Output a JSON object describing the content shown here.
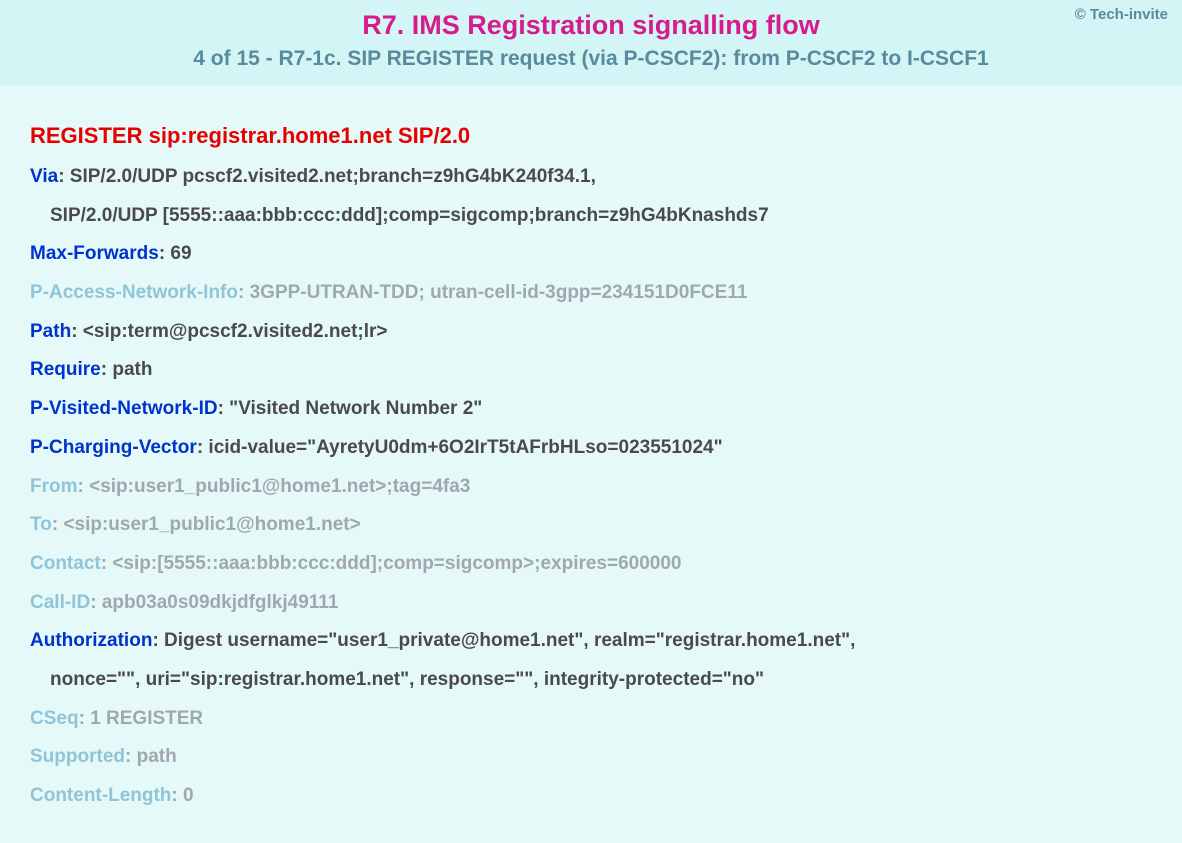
{
  "header": {
    "title": "R7. IMS Registration signalling flow",
    "subtitle": "4 of 15 - R7-1c. SIP REGISTER request (via P-CSCF2): from P-CSCF2 to I-CSCF1",
    "copyright": "© Tech-invite"
  },
  "request": {
    "method": "REGISTER",
    "uri": "sip:registrar.home1.net SIP/2.0"
  },
  "headers": {
    "via": {
      "name": "Via",
      "value1": ": SIP/2.0/UDP pcscf2.visited2.net;branch=z9hG4bK240f34.1,",
      "value2": "SIP/2.0/UDP [5555::aaa:bbb:ccc:ddd];comp=sigcomp;branch=z9hG4bKnashds7"
    },
    "maxforwards": {
      "name": "Max-Forwards",
      "value": ": 69"
    },
    "pani": {
      "name": "P-Access-Network-Info",
      "value": ": 3GPP-UTRAN-TDD; utran-cell-id-3gpp=234151D0FCE11"
    },
    "path": {
      "name": "Path",
      "value": ": <sip:term@pcscf2.visited2.net;lr>"
    },
    "require": {
      "name": "Require",
      "value": ": path"
    },
    "pvni": {
      "name": "P-Visited-Network-ID",
      "value": ": \"Visited Network Number 2\""
    },
    "pcv": {
      "name": "P-Charging-Vector",
      "value": ": icid-value=\"AyretyU0dm+6O2IrT5tAFrbHLso=023551024\""
    },
    "from": {
      "name": "From",
      "value": ": <sip:user1_public1@home1.net>;tag=4fa3"
    },
    "to": {
      "name": "To",
      "value": ": <sip:user1_public1@home1.net>"
    },
    "contact": {
      "name": "Contact",
      "value": ": <sip:[5555::aaa:bbb:ccc:ddd];comp=sigcomp>;expires=600000"
    },
    "callid": {
      "name": "Call-ID",
      "value": ": apb03a0s09dkjdfglkj49111"
    },
    "auth": {
      "name": "Authorization",
      "value1": ": Digest username=\"user1_private@home1.net\", realm=\"registrar.home1.net\",",
      "value2": "nonce=\"\", uri=\"sip:registrar.home1.net\", response=\"\", integrity-protected=\"no\""
    },
    "cseq": {
      "name": "CSeq",
      "value": ": 1 REGISTER"
    },
    "supported": {
      "name": "Supported",
      "value": ": path"
    },
    "contentlength": {
      "name": "Content-Length",
      "value": ": 0"
    }
  }
}
